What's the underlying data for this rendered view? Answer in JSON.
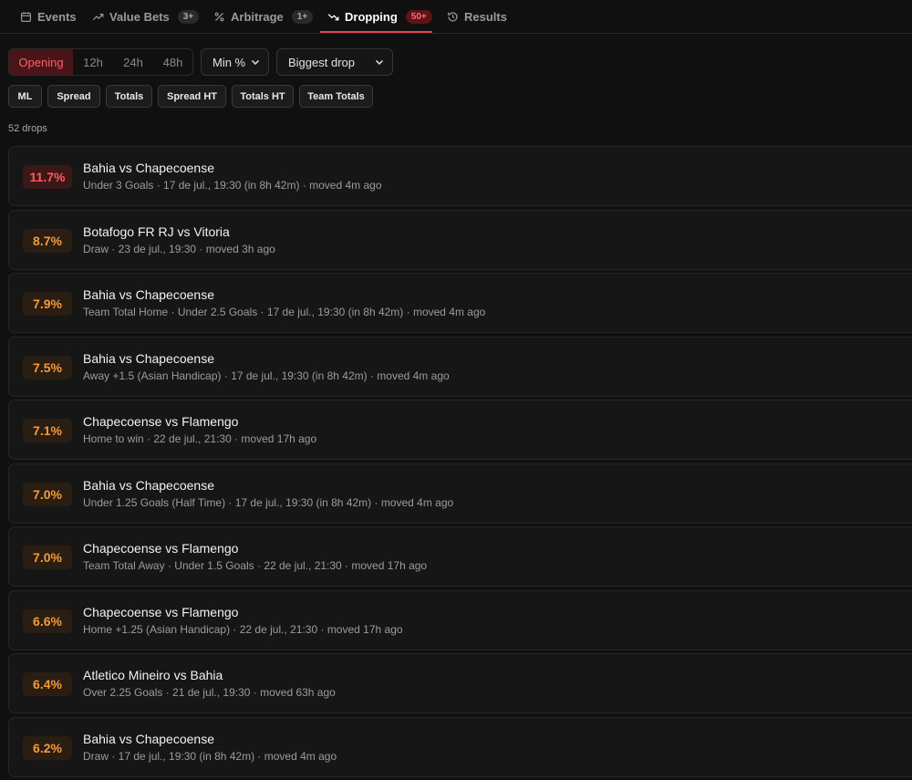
{
  "nav": {
    "tabs": [
      {
        "label": "Events",
        "badge": "",
        "icon": "calendar-icon"
      },
      {
        "label": "Value Bets",
        "badge": "3+",
        "icon": "trending-up-icon"
      },
      {
        "label": "Arbitrage",
        "badge": "1+",
        "icon": "percent-icon"
      },
      {
        "label": "Dropping",
        "badge": "50+",
        "icon": "trending-down-icon",
        "active": true
      },
      {
        "label": "Results",
        "badge": "",
        "icon": "history-icon"
      }
    ]
  },
  "filters": {
    "periods": [
      "Opening",
      "12h",
      "24h",
      "48h"
    ],
    "active_period": "Opening",
    "min_select": "Min %",
    "sort_select": "Biggest drop",
    "markets": [
      "ML",
      "Spread",
      "Totals",
      "Spread HT",
      "Totals HT",
      "Team Totals"
    ]
  },
  "summary": {
    "count_text": "52 drops"
  },
  "colors": {
    "accent": "#e0434a",
    "hot_drop": "#ff5c5c",
    "drop": "#f49a3b",
    "background": "#101010"
  },
  "drops": [
    {
      "pct": "11.7%",
      "match": "Bahia vs Chapecoense",
      "meta": "Under 3 Goals · 17 de jul., 19:30 (in 8h 42m) · moved 4m ago",
      "hot": true
    },
    {
      "pct": "8.7%",
      "match": "Botafogo FR RJ vs Vitoria",
      "meta": "Draw · 23 de jul., 19:30 · moved 3h ago",
      "hot": false
    },
    {
      "pct": "7.9%",
      "match": "Bahia vs Chapecoense",
      "meta": "Team Total Home · Under 2.5 Goals · 17 de jul., 19:30 (in 8h 42m) · moved 4m ago",
      "hot": false
    },
    {
      "pct": "7.5%",
      "match": "Bahia vs Chapecoense",
      "meta": "Away +1.5 (Asian Handicap) · 17 de jul., 19:30 (in 8h 42m) · moved 4m ago",
      "hot": false
    },
    {
      "pct": "7.1%",
      "match": "Chapecoense vs Flamengo",
      "meta": "Home to win · 22 de jul., 21:30 · moved 17h ago",
      "hot": false
    },
    {
      "pct": "7.0%",
      "match": "Bahia vs Chapecoense",
      "meta": "Under 1.25 Goals (Half Time) · 17 de jul., 19:30 (in 8h 42m) · moved 4m ago",
      "hot": false
    },
    {
      "pct": "7.0%",
      "match": "Chapecoense vs Flamengo",
      "meta": "Team Total Away · Under 1.5 Goals · 22 de jul., 21:30 · moved 17h ago",
      "hot": false
    },
    {
      "pct": "6.6%",
      "match": "Chapecoense vs Flamengo",
      "meta": "Home +1.25 (Asian Handicap) · 22 de jul., 21:30 · moved 17h ago",
      "hot": false
    },
    {
      "pct": "6.4%",
      "match": "Atletico Mineiro vs Bahia",
      "meta": "Over 2.25 Goals · 21 de jul., 19:30 · moved 63h ago",
      "hot": false
    },
    {
      "pct": "6.2%",
      "match": "Bahia vs Chapecoense",
      "meta": "Draw · 17 de jul., 19:30 (in 8h 42m) · moved 4m ago",
      "hot": false
    }
  ]
}
